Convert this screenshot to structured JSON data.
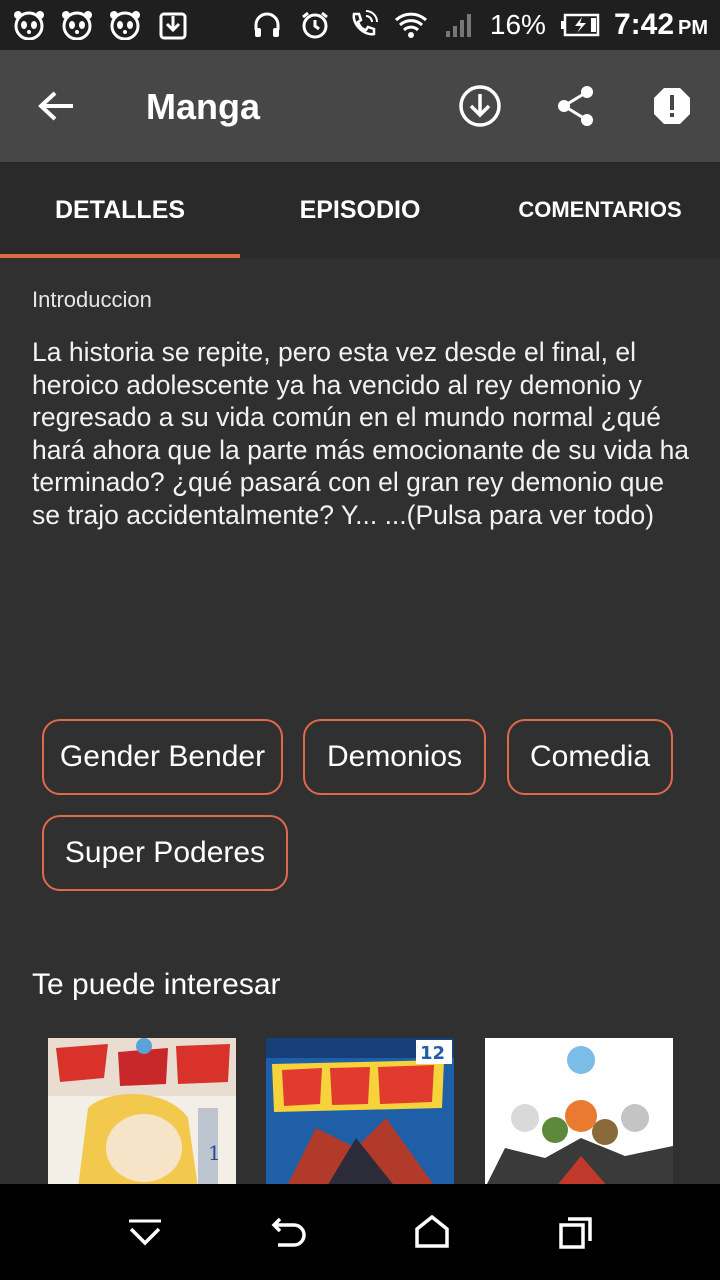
{
  "status_bar": {
    "battery": "16%",
    "time": "7:42",
    "ampm": "PM",
    "left_icons": [
      "panda-icon",
      "panda-icon",
      "panda-icon",
      "download-notification-icon"
    ],
    "right_icons": [
      "headphones-icon",
      "alarm-icon",
      "call-icon",
      "wifi-icon",
      "signal-icon",
      "battery-charging-icon"
    ]
  },
  "app_bar": {
    "title": "Manga",
    "actions": [
      "download-icon",
      "share-icon",
      "report-icon"
    ]
  },
  "tabs": [
    {
      "label": "DETALLES",
      "active": true
    },
    {
      "label": "EPISODIO",
      "active": false
    },
    {
      "label": "COMENTARIOS",
      "active": false
    }
  ],
  "details": {
    "intro_label": "Introduccion",
    "intro_text": "La historia se repite, pero esta vez desde el final, el heroico adolescente ya ha vencido al rey demonio y regresado a su vida común en el mundo normal ¿qué hará ahora que la parte más emocionante de su vida ha terminado? ¿qué pasará con el gran rey demonio que se trajo accidentalmente? Y... ...(Pulsa para ver todo)",
    "tags": [
      "Gender Bender",
      "Demonios",
      "Comedia",
      "Super Poderes"
    ]
  },
  "recommendations": {
    "title": "Te puede interesar",
    "covers": [
      {
        "name": "cover-1",
        "palette": [
          "#f4efe6",
          "#d8322b",
          "#f2c94c"
        ]
      },
      {
        "name": "cover-2",
        "palette": [
          "#1e5fa8",
          "#e03b2e",
          "#f6d33a"
        ],
        "volume": "12"
      },
      {
        "name": "cover-3",
        "palette": [
          "#ffffff",
          "#ea7a2f",
          "#7bbde6"
        ]
      }
    ]
  },
  "accent_color": "#e0694c",
  "nav_bar": {
    "buttons": [
      "hide-keyboard-icon",
      "back-icon",
      "home-icon",
      "recents-icon"
    ]
  }
}
